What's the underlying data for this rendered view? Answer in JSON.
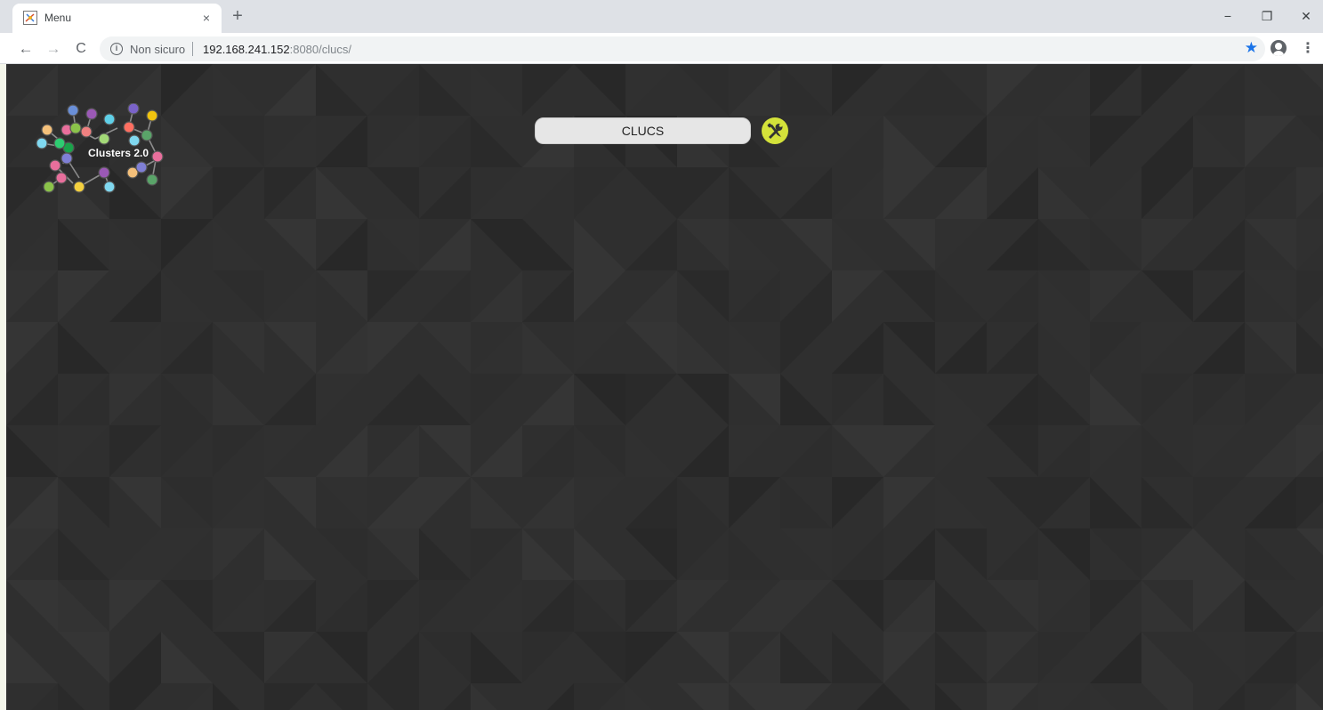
{
  "browser": {
    "tab": {
      "title": "Menu",
      "close_glyph": "×"
    },
    "new_tab_glyph": "+",
    "window_controls": {
      "minimize": "−",
      "maximize": "❐",
      "close": "✕"
    },
    "toolbar": {
      "back_glyph": "←",
      "forward_glyph": "→",
      "reload_glyph": "C",
      "security_label": "Non sicuro",
      "url_host": "192.168.241.152",
      "url_rest": ":8080/clucs/",
      "bookmark_glyph": "★",
      "menu_glyph": "⋮"
    }
  },
  "page": {
    "logo": {
      "text": "Clusters 2.0"
    },
    "main_button_label": "CLUCS",
    "tools_icon": "wrench-screwdriver-icon"
  },
  "colors": {
    "background": "#2f2f2f",
    "tools_button": "#d4e23a",
    "star": "#1a73e8"
  }
}
